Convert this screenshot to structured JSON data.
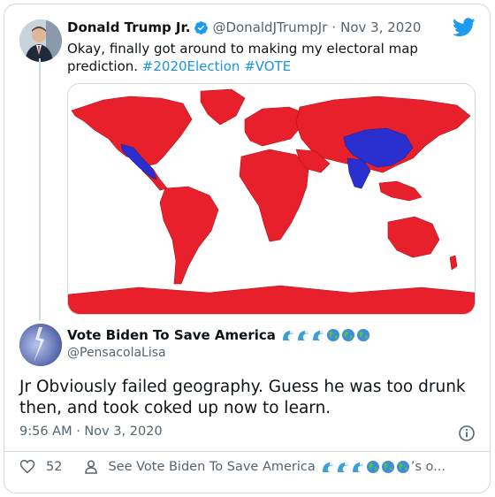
{
  "quoted_tweet": {
    "author_name": "Donald Trump Jr.",
    "handle": "@DonaldJTrumpJr",
    "separator": "·",
    "date": "Nov 3, 2020",
    "text": "Okay, finally got around to making my electoral map prediction. ",
    "hashtags": [
      "#2020Election",
      "#VOTE"
    ],
    "image_description_icon": "world-map-icon"
  },
  "reply_tweet": {
    "author_name": "Vote Biden To Save America",
    "name_emojis": [
      "wave-icon",
      "wave-icon",
      "wave-icon",
      "globe-icon",
      "globe-icon",
      "globe-icon"
    ],
    "handle": "@PensacolaLisa",
    "text": "Jr Obviously failed geography.  Guess he was too drunk then,  and took coked up now to  learn.",
    "timestamp": "9:56 AM · Nov 3, 2020"
  },
  "footer": {
    "likes": "52",
    "see_prefix": "See Vote Biden To Save America",
    "see_suffix": "’s o..."
  },
  "colors": {
    "twitter_blue": "#1d9bf0",
    "map_red": "#e8202c",
    "map_blue": "#2a2fd0",
    "text_secondary": "#536471"
  }
}
